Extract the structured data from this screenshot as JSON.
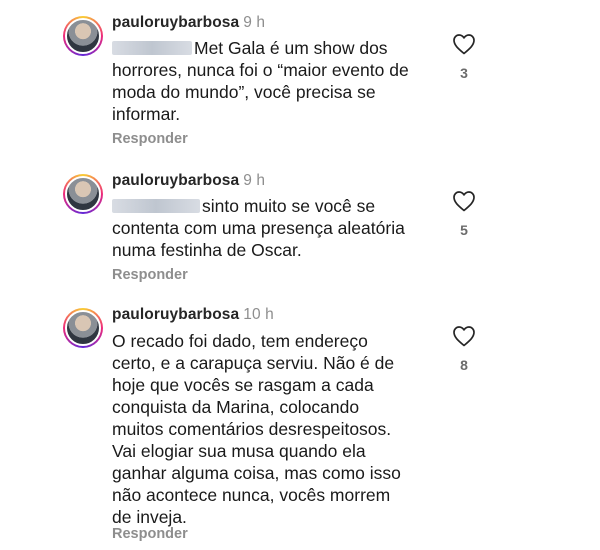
{
  "comments": [
    {
      "username": "pauloruybarbosa",
      "time": "9 h",
      "text": "Met Gala é um show dos\nhorrores, nunca foi o “maior evento de\nmoda do mundo”, você precisa se\ninformar.",
      "reply_label": "Responder",
      "likes": "3"
    },
    {
      "username": "pauloruybarbosa",
      "time": "9 h",
      "text": "sinto muito se você se\ncontenta com uma presença aleatória\nnuma festinha de Oscar.",
      "reply_label": "Responder",
      "likes": "5"
    },
    {
      "username": "pauloruybarbosa",
      "time": "10 h",
      "text": "O recado foi dado, tem endereço\ncerto, e a carapuça serviu. Não é de\nhoje que vocês se rasgam a cada\nconquista da Marina, colocando\nmuitos comentários desrespeitosos.\nVai elogiar sua musa quando ela\nganhar alguma coisa, mas como isso\nnão acontece nunca, vocês morrem\nde inveja.",
      "reply_label": "Responder",
      "likes": "8"
    }
  ],
  "icons": {
    "like": "heart-outline-icon",
    "avatar": "profile-avatar"
  },
  "colors": {
    "muted": "#8e8e8e",
    "text": "#1a1a1a"
  }
}
